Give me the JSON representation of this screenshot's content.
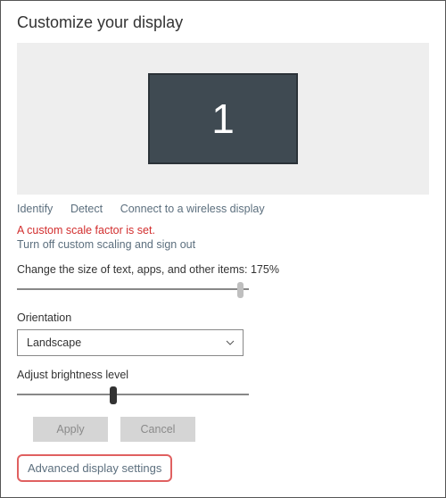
{
  "title": "Customize your display",
  "monitor": {
    "label": "1"
  },
  "links": {
    "identify": "Identify",
    "detect": "Detect",
    "connect_wireless": "Connect to a wireless display"
  },
  "warning": {
    "text": "A custom scale factor is set.",
    "action": "Turn off custom scaling and sign out"
  },
  "scale": {
    "label": "Change the size of text, apps, and other items: 175%",
    "percent": 175,
    "thumb_pos_pct": 95
  },
  "orientation": {
    "label": "Orientation",
    "value": "Landscape"
  },
  "brightness": {
    "label": "Adjust brightness level",
    "thumb_pos_pct": 40
  },
  "buttons": {
    "apply": "Apply",
    "cancel": "Cancel"
  },
  "advanced_link": "Advanced display settings"
}
